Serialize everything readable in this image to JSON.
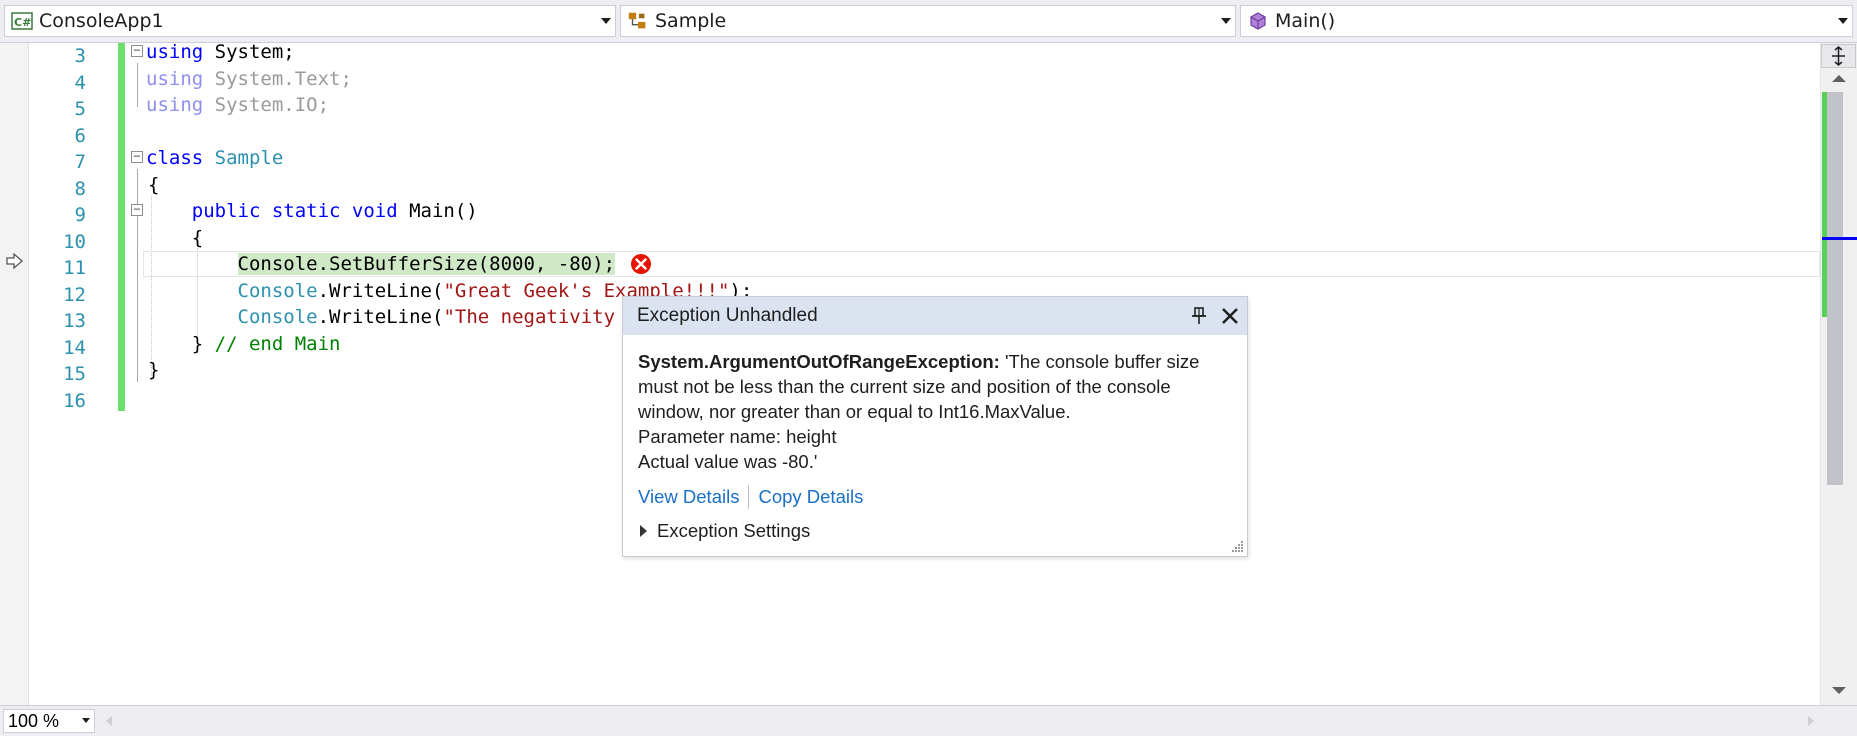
{
  "navbar": {
    "project": {
      "label": "ConsoleApp1",
      "icon": "csharp-project-icon"
    },
    "type": {
      "label": "Sample",
      "icon": "class-icon"
    },
    "member": {
      "label": "Main()",
      "icon": "method-icon"
    }
  },
  "line_numbers": [
    "3",
    "4",
    "5",
    "6",
    "7",
    "8",
    "9",
    "10",
    "11",
    "12",
    "13",
    "14",
    "15",
    "16"
  ],
  "code": {
    "l3": {
      "kw": "using",
      "rest": " System;"
    },
    "l4": {
      "kw": "using",
      "rest": " System.Text;"
    },
    "l5": {
      "kw": "using",
      "rest": " System.IO;"
    },
    "l7": {
      "kw": "class",
      "name": "Sample"
    },
    "l8": {
      "text": "{"
    },
    "l9": {
      "indent": "    ",
      "kw": "public static void",
      "rest": " Main()"
    },
    "l10": {
      "text": "    {"
    },
    "l11": {
      "indent": "        ",
      "text": "Console.SetBufferSize(8000, -80);"
    },
    "l12": {
      "indent": "        ",
      "type": "Console",
      "call": ".WriteLine(",
      "str": "\"Great Geek's Example!!!\"",
      "end": ");"
    },
    "l13": {
      "indent": "        ",
      "type": "Console",
      "call": ".WriteLine(",
      "str": "\"The negativity c"
    },
    "l14": {
      "indent": "    ",
      "brace": "}",
      "comment": " // end Main"
    },
    "l15": {
      "text": "}"
    }
  },
  "exception": {
    "title": "Exception Unhandled",
    "exception_type": "System.ArgumentOutOfRangeException:",
    "message": " 'The console buffer size must not be less than the current size and position of the console window, nor greater than or equal to Int16.MaxValue.",
    "param_line": "Parameter name: height",
    "actual_line": "Actual value was -80.'",
    "view_details": "View Details",
    "copy_details": "Copy Details",
    "settings_label": "Exception Settings"
  },
  "zoom": {
    "value": "100 %"
  },
  "colors": {
    "keyword": "#0000ff",
    "type": "#2b91af",
    "string": "#a31515",
    "comment": "#008000",
    "change_bar": "#6ce06c",
    "error": "#e51400",
    "link": "#1a6fc7"
  }
}
